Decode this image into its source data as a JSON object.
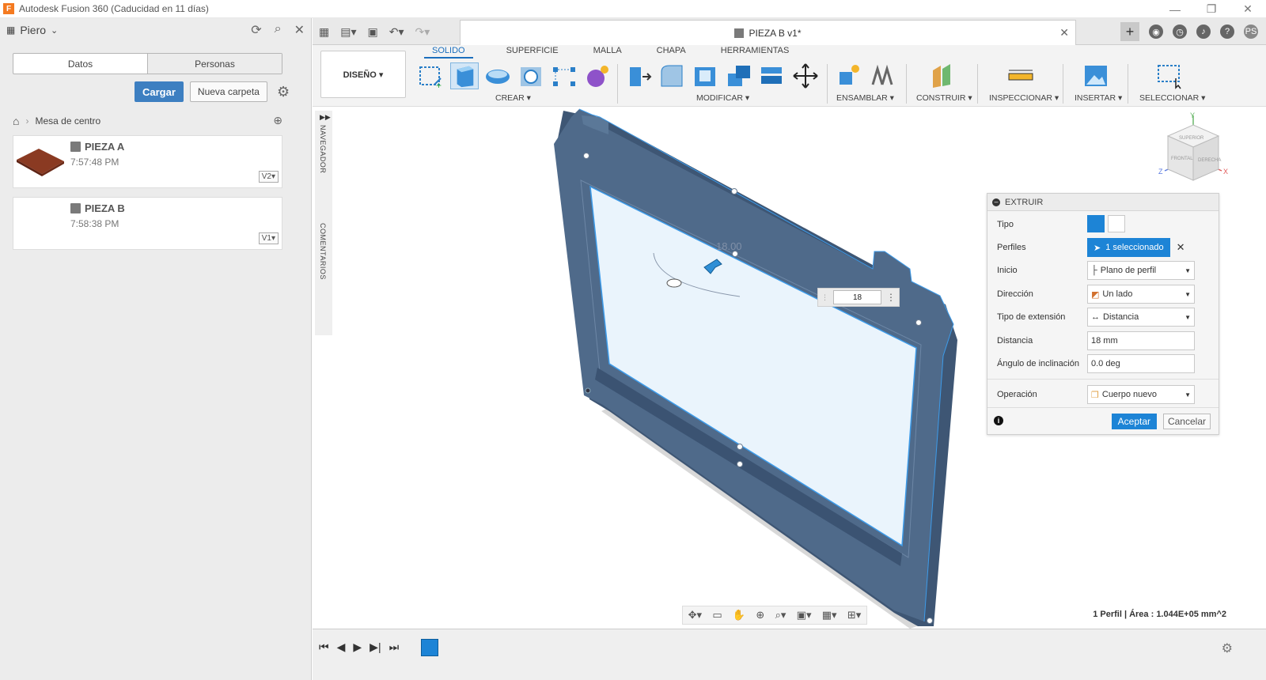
{
  "window": {
    "title": "Autodesk Fusion 360 (Caducidad en 11 días)",
    "logo_letter": "F",
    "controls": [
      "—",
      "❐",
      "✕"
    ]
  },
  "left_panel": {
    "user": "Piero",
    "tabs": [
      "Datos",
      "Personas"
    ],
    "upload_label": "Cargar",
    "new_folder_label": "Nueva carpeta",
    "breadcrumb": "Mesa de centro",
    "files": [
      {
        "name": "PIEZA A",
        "time": "7:57:48 PM",
        "version": "V2▾"
      },
      {
        "name": "PIEZA B",
        "time": "7:58:38 PM",
        "version": "V1▾"
      }
    ]
  },
  "doc_tab": {
    "title": "PIEZA B v1*"
  },
  "ribbon": {
    "workspace": "DISEÑO ▾",
    "tabs": [
      "SOLIDO",
      "SUPERFICIE",
      "MALLA",
      "CHAPA",
      "HERRAMIENTAS"
    ],
    "active_tab": "SOLIDO",
    "groups": [
      "CREAR ▾",
      "MODIFICAR ▾",
      "ENSAMBLAR ▾",
      "CONSTRUIR ▾",
      "INSPECCIONAR ▾",
      "INSERTAR ▾",
      "SELECCIONAR ▾"
    ]
  },
  "side_strip": {
    "navigator": "NAVEGADOR",
    "comments": "COMENTARIOS"
  },
  "viewcube": {
    "top": "SUPERIOR",
    "front": "FRONTAL",
    "right": "DERECHA",
    "axis_x": "X",
    "axis_y": "Y",
    "axis_z": "Z"
  },
  "viewport": {
    "dimension_label": "18.00",
    "inline_input": "18"
  },
  "dialog": {
    "title": "EXTRUIR",
    "rows": {
      "tipo": "Tipo",
      "perfiles": "Perfiles",
      "perfiles_value": "1 seleccionado",
      "inicio": "Inicio",
      "inicio_value": "Plano de perfil",
      "direccion": "Dirección",
      "direccion_value": "Un lado",
      "tipo_ext": "Tipo de extensión",
      "tipo_ext_value": "Distancia",
      "distancia": "Distancia",
      "distancia_value": "18 mm",
      "angulo": "Ángulo de inclinación",
      "angulo_value": "0.0 deg",
      "operacion": "Operación",
      "operacion_value": "Cuerpo nuevo"
    },
    "ok_label": "Aceptar",
    "cancel_label": "Cancelar"
  },
  "status_text": "1 Perfil | Área : 1.044E+05 mm^2",
  "colors": {
    "accent": "#1d84d6",
    "primary_button": "#3d7fc1",
    "body_face": "#4f6a8a",
    "profile_fill": "#eaf4fc"
  }
}
